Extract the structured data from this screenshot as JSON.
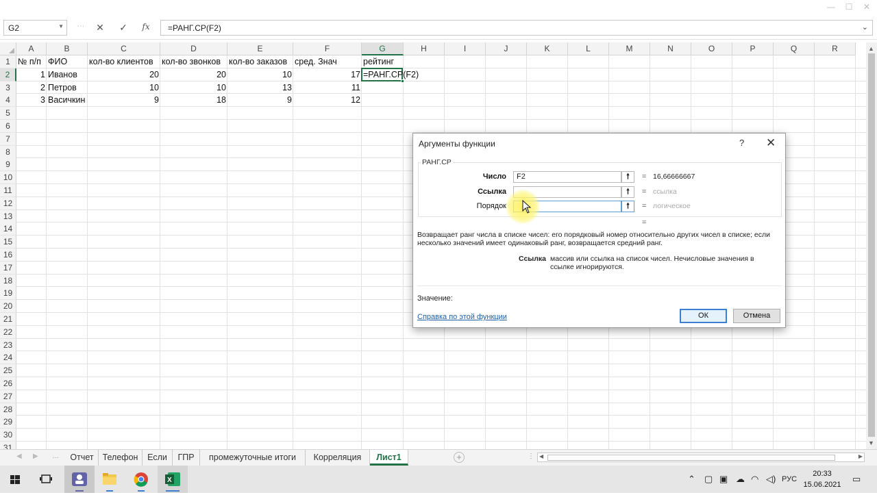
{
  "window": {
    "controls": [
      "⋯",
      "⧉",
      "—",
      "☐",
      "✕"
    ]
  },
  "formula_bar": {
    "name_box": "G2",
    "cancel_icon": "✕",
    "enter_icon": "✓",
    "fx_icon": "fx",
    "formula": "=РАНГ.СР(F2)"
  },
  "columns": [
    "A",
    "B",
    "C",
    "D",
    "E",
    "F",
    "G",
    "H",
    "I",
    "J",
    "K",
    "L",
    "M",
    "N",
    "O",
    "P",
    "Q",
    "R"
  ],
  "rows": [
    "1",
    "2",
    "3",
    "4",
    "5",
    "6",
    "7",
    "8",
    "9",
    "10",
    "11",
    "12",
    "13",
    "14",
    "15",
    "16",
    "17",
    "18",
    "19",
    "20",
    "21",
    "22",
    "23",
    "24",
    "25",
    "26",
    "27",
    "28",
    "29",
    "30",
    "31"
  ],
  "headers": {
    "A": "№ п/п",
    "B": "ФИО",
    "C": "кол-во клиентов",
    "D": "кол-во звонков",
    "E": "кол-во заказов",
    "F": "сред. Знач",
    "G": "рейтинг"
  },
  "table_rows": [
    {
      "n": "1",
      "name": "Иванов",
      "clients": "20",
      "calls": "20",
      "orders": "10",
      "avg": "17",
      "rating": "=РАНГ.СР(F2)"
    },
    {
      "n": "2",
      "name": "Петров",
      "clients": "10",
      "calls": "10",
      "orders": "13",
      "avg": "11",
      "rating": ""
    },
    {
      "n": "3",
      "name": "Васичкин",
      "clients": "9",
      "calls": "18",
      "orders": "9",
      "avg": "12",
      "rating": ""
    }
  ],
  "dialog": {
    "title": "Аргументы функции",
    "help_icon": "?",
    "close_icon": "✕",
    "function_name": "РАНГ.СР",
    "args": [
      {
        "label": "Число",
        "value": "F2",
        "result": "16,66666667",
        "bold": true
      },
      {
        "label": "Ссылка",
        "value": "",
        "result": "ссылка",
        "bold": true
      },
      {
        "label": "Порядок",
        "value": "",
        "result": "логическое",
        "bold": false
      }
    ],
    "overall_eq": "=",
    "description": "Возвращает ранг числа в списке чисел: его порядковый номер относительно других чисел в списке; если несколько значений имеет одинаковый ранг, возвращается средний ранг.",
    "arg_name": "Ссылка",
    "arg_description": "массив или ссылка на список чисел. Нечисловые значения в ссылке игнорируются.",
    "value_label": "Значение:",
    "help_link": "Справка по этой функции",
    "ok": "ОК",
    "cancel": "Отмена"
  },
  "sheets": {
    "tabs": [
      "Отчет",
      "Телефон",
      "Если",
      "ГПР",
      "промежуточные итоги",
      "Корреляция",
      "Лист1"
    ],
    "active": "Лист1",
    "add_icon": "+"
  },
  "taskbar": {
    "tray_lang": "РУС",
    "time": "20:33",
    "date": "15.06.2021"
  },
  "colors": {
    "excel_green": "#217346",
    "link_blue": "#1f5faa"
  }
}
